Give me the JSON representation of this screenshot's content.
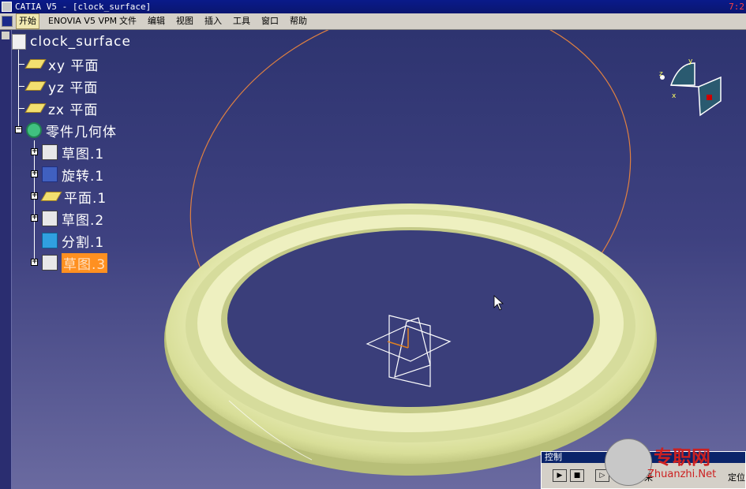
{
  "titlebar": {
    "title": "CATIA V5 - [clock_surface]",
    "clock": "7:2"
  },
  "menu": {
    "items": [
      "开始",
      "ENOVIA V5 VPM",
      "文件",
      "编辑",
      "视图",
      "插入",
      "工具",
      "窗口",
      "帮助"
    ]
  },
  "tree": {
    "root": "clock_surface",
    "planes": [
      "xy 平面",
      "yz 平面",
      "zx 平面"
    ],
    "body": "零件几何体",
    "features": [
      "草图.1",
      "旋转.1",
      "平面.1",
      "草图.2",
      "分割.1",
      "草图.3"
    ],
    "selected": "草图.3"
  },
  "compass": {
    "axis_x": "x",
    "axis_y": "y",
    "axis_z": "z"
  },
  "control_panel": {
    "title": "控制",
    "partial_label": "采",
    "partial_label2": "定位"
  },
  "watermark": {
    "text": "专职网",
    "url": "Zhuanzhi.Net"
  },
  "colors": {
    "viewport_top": "#2e3470",
    "surface": "#e6ecb0",
    "selected": "#ff9020",
    "sketch_curve": "#e08040"
  }
}
